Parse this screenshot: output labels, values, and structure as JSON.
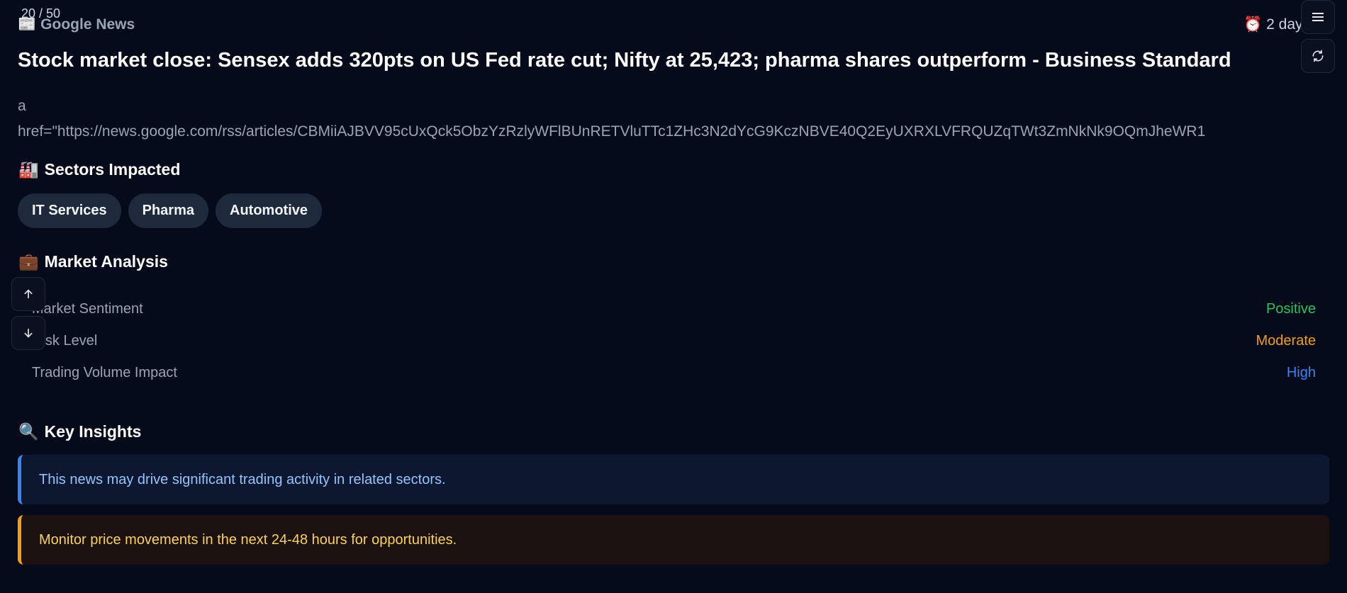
{
  "counter": "20 / 50",
  "source": {
    "icon": "newspaper-icon",
    "name": "Google News"
  },
  "time": {
    "icon": "alarm-clock-icon",
    "label": "2 days"
  },
  "headline": "Stock market close: Sensex adds 320pts on US Fed rate cut; Nifty at 25,423; pharma shares outperform - Business Standard",
  "description": {
    "line1": "a",
    "line2": "href=\"https://news.google.com/rss/articles/CBMiiAJBVV95cUxQck5ObzYzRzlyWFlBUnRETVluTTc1ZHc3N2dYcG9KczNBVE40Q2EyUXRXLVFRQUZqTWt3ZmNkNk9OQmJheWR1"
  },
  "sectors": {
    "title": "Sectors Impacted",
    "icon": "factory-icon",
    "items": [
      "IT Services",
      "Pharma",
      "Automotive"
    ]
  },
  "market_analysis": {
    "title": "Market Analysis",
    "icon": "briefcase-icon",
    "rows": [
      {
        "label": "Market Sentiment",
        "value": "Positive",
        "color": "#22c55e"
      },
      {
        "label": "Risk Level",
        "value": "Moderate",
        "color": "#f59e0b"
      },
      {
        "label": "Trading Volume Impact",
        "value": "High",
        "color": "#3b82f6"
      }
    ]
  },
  "key_insights": {
    "title": "Key Insights",
    "icon": "magnifier-icon",
    "items": [
      {
        "text": "This news may drive significant trading activity in related sectors.",
        "type": "info"
      },
      {
        "text": "Monitor price movements in the next 24-48 hours for opportunities.",
        "type": "warning"
      }
    ]
  },
  "controls": {
    "menu_icon": "hamburger-menu-icon",
    "refresh_icon": "refresh-icon",
    "up_icon": "arrow-up-icon",
    "down_icon": "arrow-down-icon"
  }
}
